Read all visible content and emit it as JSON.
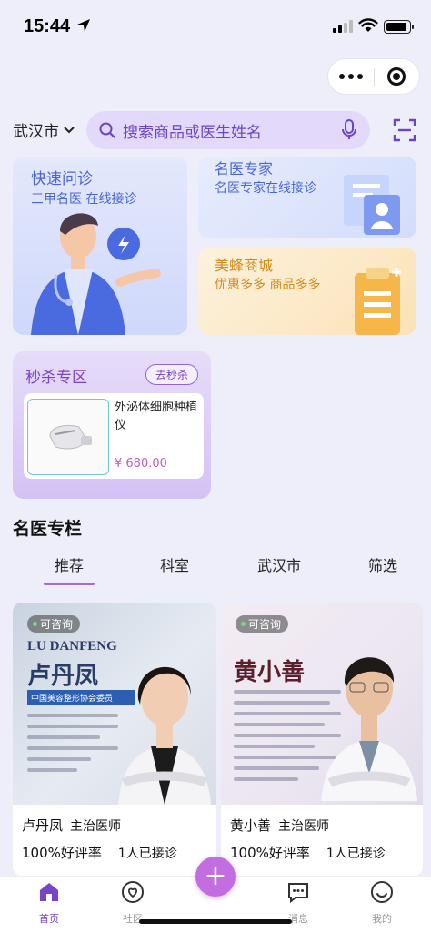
{
  "status_bar": {
    "time": "15:44"
  },
  "header": {
    "city": "武汉市",
    "search_placeholder": "搜索商品或医生姓名"
  },
  "features": {
    "consult": {
      "title": "快速问诊",
      "subtitle": "三甲名医 在线接诊"
    },
    "experts": {
      "title": "名医专家",
      "subtitle": "名医专家在线接诊"
    },
    "mall": {
      "title": "美蜂商城",
      "subtitle": "优惠多多 商品多多"
    }
  },
  "flash_sale": {
    "title": "秒杀专区",
    "go_label": "去秒杀",
    "product": {
      "name": "外泌体细胞种植仪",
      "price": "¥ 680.00"
    }
  },
  "section": {
    "title": "名医专栏",
    "tabs": [
      "推荐",
      "科室",
      "武汉市",
      "筛选"
    ],
    "active_tab": "推荐"
  },
  "doctors": [
    {
      "badge": "可咨询",
      "photo_pinyin": "LU DANFENG",
      "photo_name": "卢丹凤",
      "photo_banner": "中国美容整形协会委员",
      "name": "卢丹凤",
      "title": "主治医师",
      "rating": "100%好评率",
      "received": "1人已接诊"
    },
    {
      "badge": "可咨询",
      "photo_name": "黄小善",
      "name": "黄小善",
      "title": "主治医师",
      "rating": "100%好评率",
      "received": "1人已接诊"
    }
  ],
  "bottom_nav": [
    {
      "label": "首页",
      "icon": "home-icon",
      "active": true
    },
    {
      "label": "社区",
      "icon": "community-icon",
      "active": false
    },
    {
      "label": "",
      "icon": "plus-icon",
      "active": false
    },
    {
      "label": "消息",
      "icon": "message-icon",
      "active": false
    },
    {
      "label": "我的",
      "icon": "profile-icon",
      "active": false
    }
  ],
  "colors": {
    "accent": "#a36adf",
    "search_bg": "#e3d9fa",
    "page_bg": "#eeeefb"
  }
}
